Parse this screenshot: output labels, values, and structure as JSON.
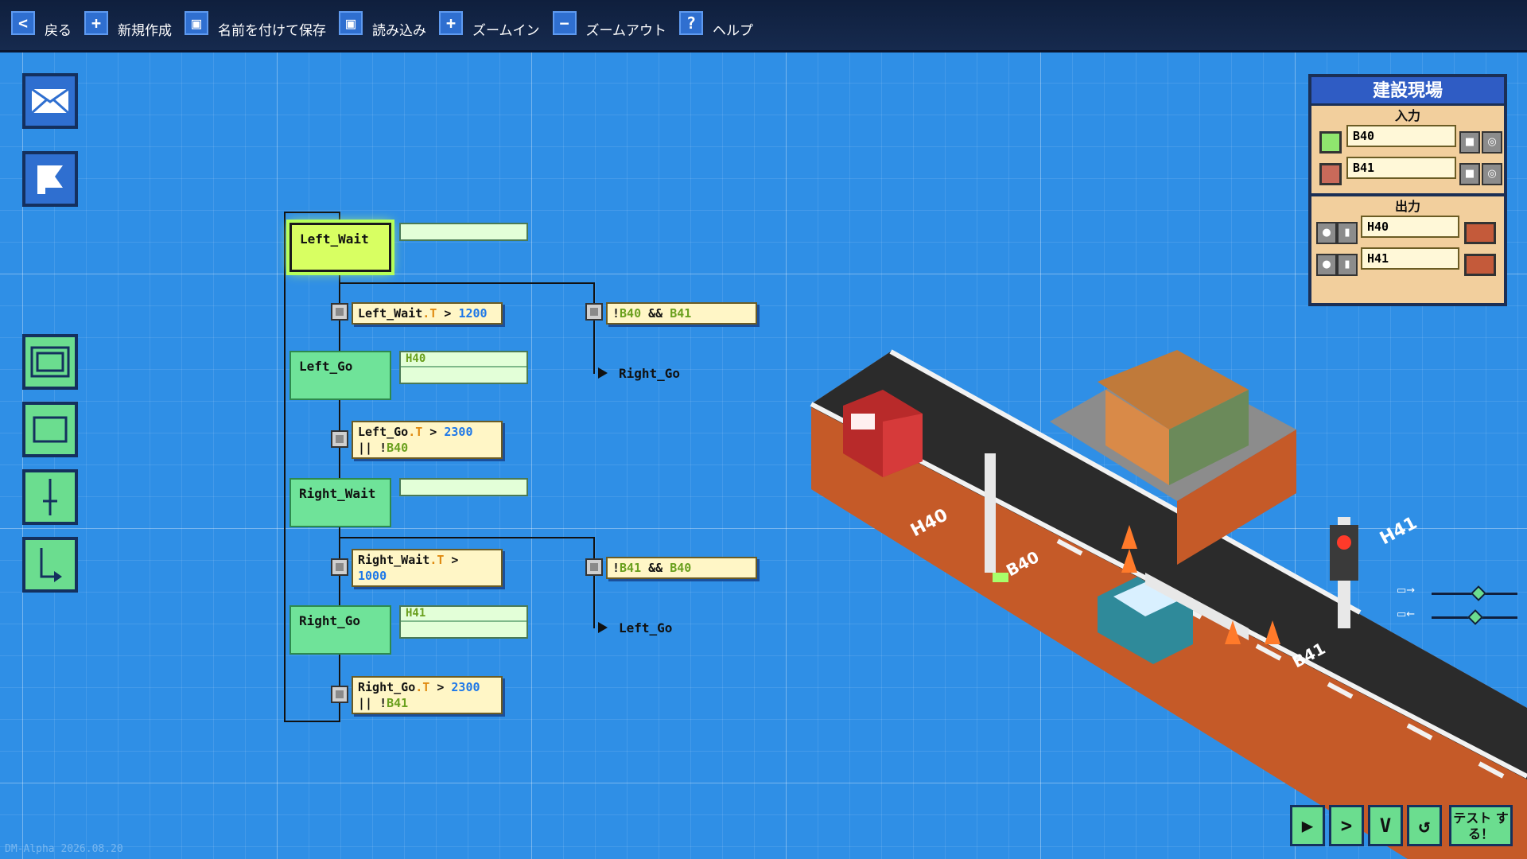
{
  "toolbar": {
    "back": "戻る",
    "new": "新規作成",
    "save_as": "名前を付けて保存",
    "load": "読み込み",
    "zoom_in": "ズームイン",
    "zoom_out": "ズームアウト",
    "help": "ヘルプ"
  },
  "icons": {
    "back": "share-icon",
    "new": "plus-icon",
    "save_as": "floppy-disk-icon",
    "load": "floppy-disk-icon",
    "zoom_in": "plus-icon",
    "zoom_out": "minus-icon",
    "help": "question-mark-icon"
  },
  "tools": [
    "envelope-tool",
    "flag-tool",
    "initial-state-tool",
    "state-tool",
    "transition-tool",
    "jump-tool"
  ],
  "flow": {
    "states": [
      {
        "name": "Left_Wait",
        "outputs": [],
        "active": true
      },
      {
        "name": "Left_Go",
        "outputs": [
          "H40"
        ],
        "active": false
      },
      {
        "name": "Right_Wait",
        "outputs": [],
        "active": false
      },
      {
        "name": "Right_Go",
        "outputs": [
          "H41"
        ],
        "active": false
      }
    ],
    "conditions": {
      "c1": {
        "state": "Left_Wait",
        "timer": ".T",
        "op": " > ",
        "value": "1200"
      },
      "c2": {
        "not": "!",
        "a": "B40",
        "and": " && ",
        "b": "B41"
      },
      "c3": {
        "state": "Left_Go",
        "timer": ".T",
        "op": " > ",
        "value": "2300",
        "or": "|| !",
        "sensor": "B40"
      },
      "c4": {
        "state": "Right_Wait",
        "timer": ".T",
        "op": " >",
        "value": "1000"
      },
      "c5": {
        "not": "!",
        "a": "B41",
        "and": " && ",
        "b": "B40"
      },
      "c6": {
        "state": "Right_Go",
        "timer": ".T",
        "op": " > ",
        "value": "2300",
        "or": "|| !",
        "sensor": "B41"
      }
    },
    "jumps": {
      "j1": "Right_Go",
      "j2": "Left_Go"
    }
  },
  "panel": {
    "title": "建設現場",
    "input_label": "入力",
    "output_label": "出力",
    "inputs": [
      {
        "name": "B40",
        "state": "on"
      },
      {
        "name": "B41",
        "state": "off"
      }
    ],
    "outputs": [
      {
        "name": "H40"
      },
      {
        "name": "H41"
      }
    ]
  },
  "scene": {
    "labels": {
      "h40": "H40",
      "b40": "B40",
      "b41": "B41",
      "h41": "H41"
    }
  },
  "controls": {
    "play": "▶",
    "step": ">",
    "down": "V",
    "reset": "↺",
    "test": "テスト する！"
  },
  "version": "DM-Alpha 2026.08.20",
  "colors": {
    "grid_bg": "#2f8fe6",
    "state_green": "#6fe399",
    "active_state": "#d8ff62",
    "condition_bg": "#fff6c6",
    "timer_orange": "#e08a10",
    "number_blue": "#1e78e8",
    "sensor_green": "#6aa01e",
    "panel_bg": "#f2cf9d",
    "panel_header": "#2f5cc4"
  }
}
